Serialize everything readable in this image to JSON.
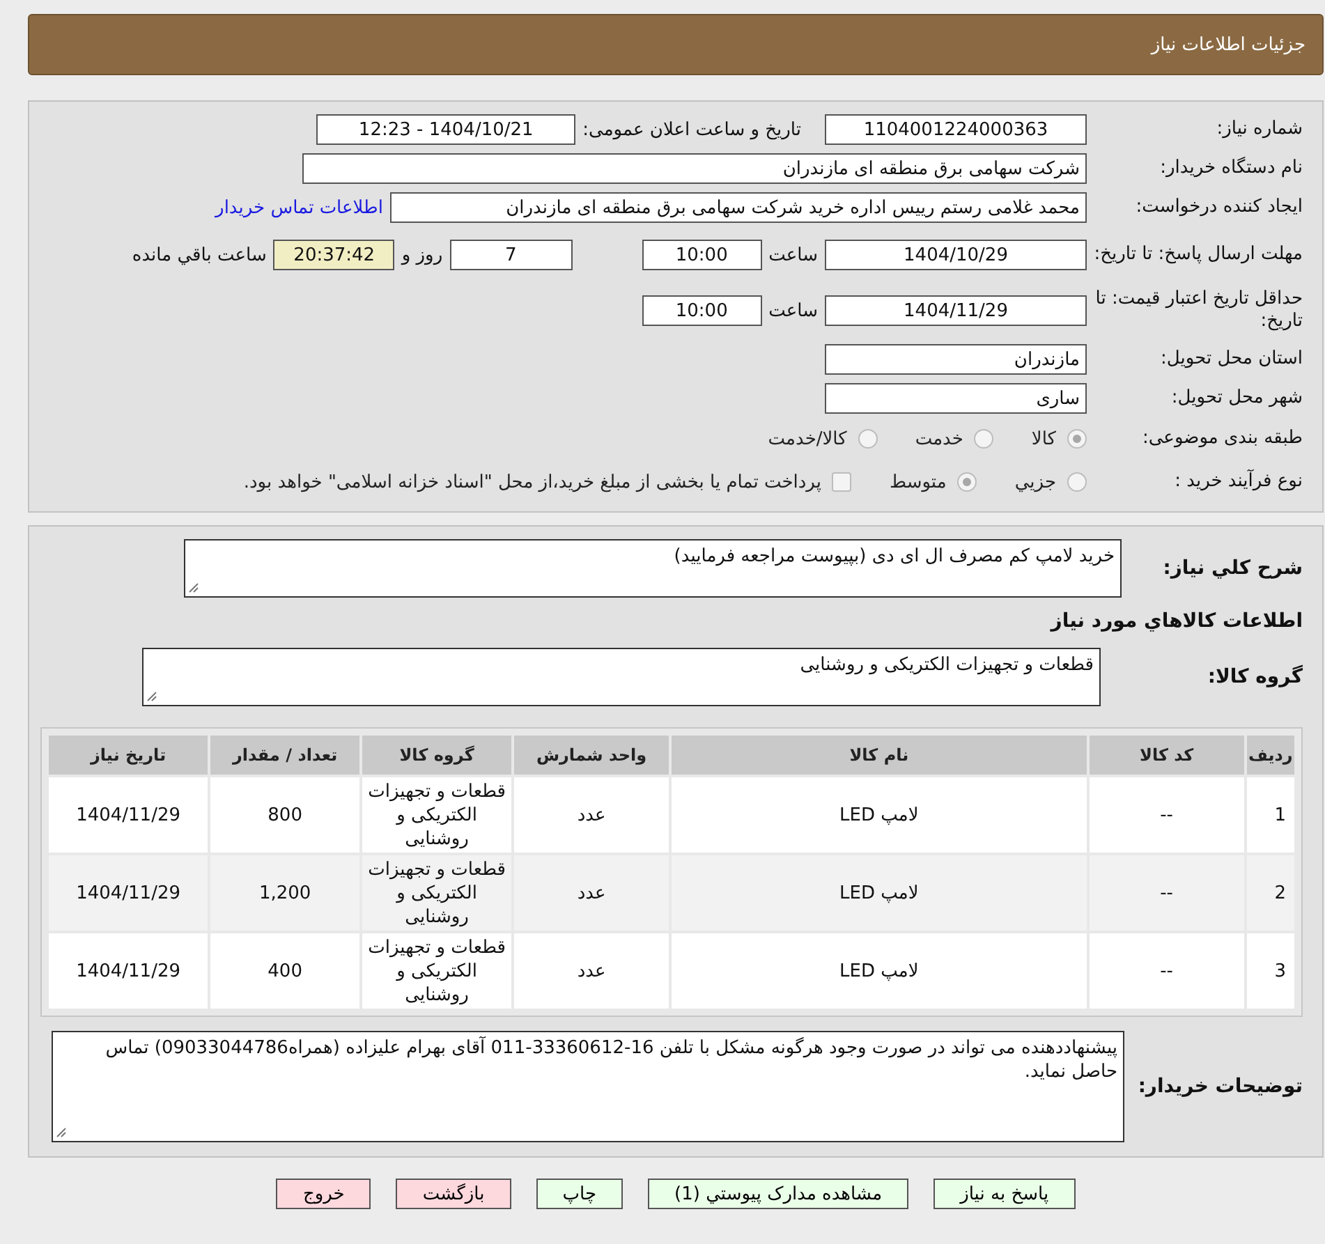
{
  "header": {
    "title": "جزئیات اطلاعات نیاز"
  },
  "details": {
    "need_number": {
      "label": "شماره نیاز:",
      "value": "1104001224000363"
    },
    "announce": {
      "label": "تاریخ و ساعت اعلان عمومی:",
      "value": "1404/10/21 - 12:23"
    },
    "buyer": {
      "label": "نام دستگاه خریدار:",
      "value": "شرکت سهامی برق منطقه ای مازندران"
    },
    "requester": {
      "label": "ایجاد کننده درخواست:",
      "value": "محمد غلامی رستم رییس اداره خرید شرکت سهامی برق منطقه ای مازندران",
      "link": "اطلاعات تماس خریدار"
    },
    "deadline": {
      "label": "مهلت ارسال پاسخ: تا تاریخ:",
      "date": "1404/10/29",
      "time_label": "ساعت",
      "time": "10:00",
      "days": "7",
      "days_label": "روز و",
      "remaining": "20:37:42",
      "remaining_label": "ساعت باقي مانده"
    },
    "validity": {
      "label": "حداقل تاریخ اعتبار قیمت: تا تاریخ:",
      "date": "1404/11/29",
      "time_label": "ساعت",
      "time": "10:00"
    },
    "province": {
      "label": "استان محل تحویل:",
      "value": "مازندران"
    },
    "city": {
      "label": "شهر محل تحویل:",
      "value": "ساری"
    },
    "category": {
      "label": "طبقه بندی موضوعی:",
      "options": [
        {
          "label": "کالا",
          "selected": true
        },
        {
          "label": "خدمت",
          "selected": false
        },
        {
          "label": "کالا/خدمت",
          "selected": false
        }
      ]
    },
    "process": {
      "label": "نوع فرآیند خرید :",
      "options": [
        {
          "label": "جزيي",
          "selected": false
        },
        {
          "label": "متوسط",
          "selected": true
        }
      ],
      "payment": {
        "label": "پرداخت تمام یا بخشی از مبلغ خرید،از محل \"اسناد خزانه اسلامی\" خواهد بود.",
        "checked": false
      }
    }
  },
  "items": {
    "summary": {
      "label": "شرح کلي نیاز:",
      "value": "خرید لامپ کم مصرف ال ای دی (بپیوست مراجعه فرمایید)"
    },
    "heading": "اطلاعات کالاهاي مورد نیاز",
    "group": {
      "label": "گروه کالا:",
      "value": "قطعات و تجهیزات الکتریکی و روشنایی"
    },
    "table": {
      "columns": [
        "ردیف",
        "کد کالا",
        "نام کالا",
        "واحد شمارش",
        "گروه کالا",
        "تعداد / مقدار",
        "تاریخ نیاز"
      ],
      "rows": [
        [
          "1",
          "--",
          "لامپ LED",
          "عدد",
          "قطعات و تجهیزات الکتریکی و روشنایی",
          "800",
          "1404/11/29"
        ],
        [
          "2",
          "--",
          "لامپ LED",
          "عدد",
          "قطعات و تجهیزات الکتریکی و روشنایی",
          "1,200",
          "1404/11/29"
        ],
        [
          "3",
          "--",
          "لامپ LED",
          "عدد",
          "قطعات و تجهیزات الکتریکی و روشنایی",
          "400",
          "1404/11/29"
        ]
      ]
    },
    "notes": {
      "label": "توضیحات خریدار:",
      "value": "پیشنهاددهنده می تواند در صورت وجود هرگونه مشکل با تلفن 16-33360612-011 آقای بهرام علیزاده (همراه09033044786) تماس حاصل نماید."
    }
  },
  "buttons": [
    {
      "label": "پاسخ به نیاز",
      "kind": "action"
    },
    {
      "label": "مشاهده مدارک پیوستي (1)",
      "kind": "action"
    },
    {
      "label": "چاپ",
      "kind": "action"
    },
    {
      "label": "بازگشت",
      "kind": "exit"
    },
    {
      "label": "خروج",
      "kind": "exit"
    }
  ]
}
